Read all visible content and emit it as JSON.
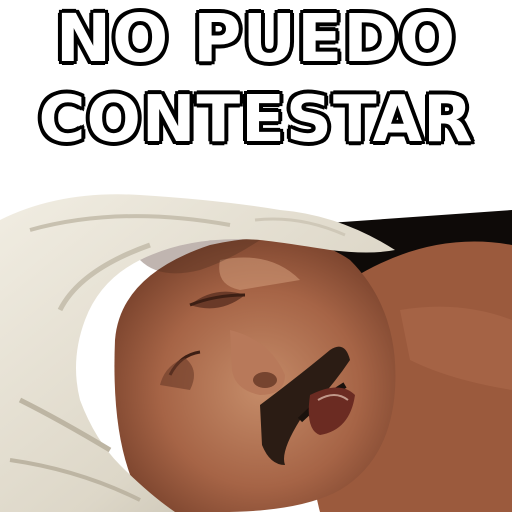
{
  "caption": {
    "line1": "NO PUEDO",
    "line2": "CONTESTAR"
  },
  "image": {
    "subject": "sleeping-man-with-towel-on-head"
  }
}
